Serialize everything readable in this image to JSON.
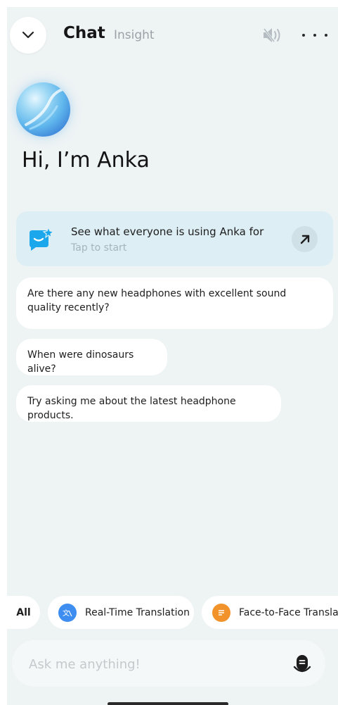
{
  "header": {
    "tabs": [
      {
        "label": "Chat",
        "active": true
      },
      {
        "label": "Insight",
        "active": false
      }
    ],
    "icons": [
      "chevron-down-icon",
      "speaker-muted-icon",
      "more-horizontal-icon"
    ]
  },
  "greeting": "Hi, I’m Anka",
  "promo": {
    "title": "See what everyone is using Anka for",
    "subtitle": "Tap to start",
    "icon": "chat-star-icon",
    "action_icon": "arrow-up-right-icon"
  },
  "suggestions": [
    "Are there any new headphones with excellent sound quality recently?",
    "When were dinosaurs alive?",
    "Try asking me about the latest headphone products."
  ],
  "chips": [
    {
      "label": "All"
    },
    {
      "label": "Real-Time Translation",
      "icon": "translate-icon",
      "color": "#3d8ef0"
    },
    {
      "label": "Face-to-Face Translati",
      "icon": "document-icon",
      "color": "#f2922a"
    }
  ],
  "input": {
    "placeholder": "Ask me anything!",
    "value": "",
    "mic_icon": "microphone-icon"
  },
  "colors": {
    "background": "#eef3f4",
    "promo_card": "#ddeef4",
    "promo_icon": "#1aa7ec",
    "translate_chip": "#3d8ef0",
    "face_chip": "#f2922a"
  }
}
